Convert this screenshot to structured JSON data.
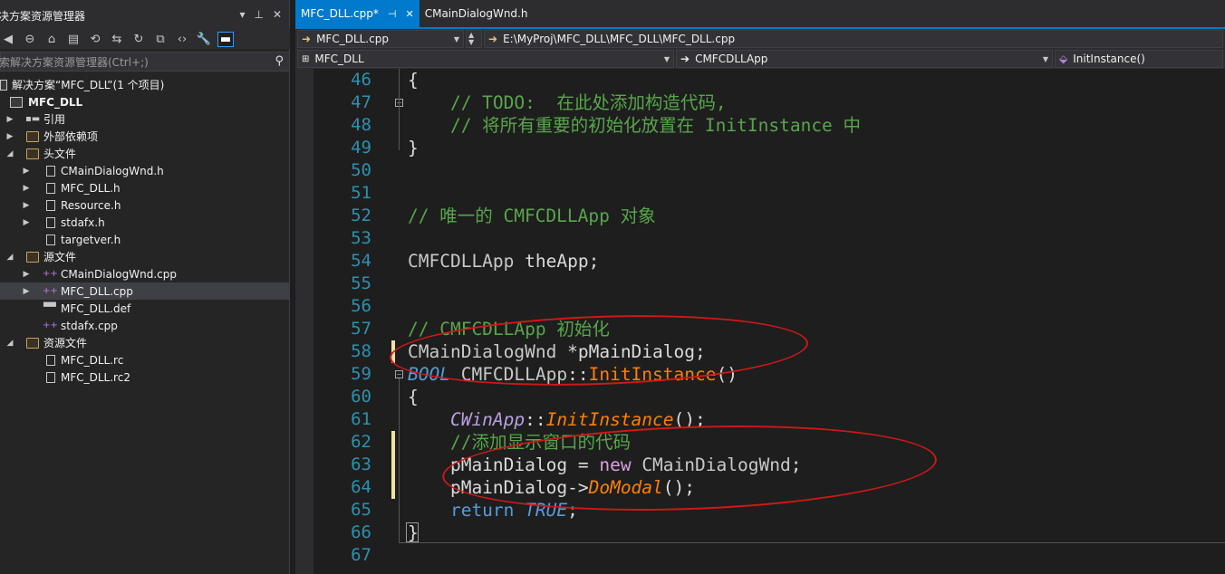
{
  "explorer": {
    "title": "决方案资源管理器",
    "search_placeholder": "索解决方案资源管理器(Ctrl+;)",
    "tree": [
      {
        "label": "解决方案“MFC_DLL”(1 个项目)",
        "icon": "solution-icon",
        "arrow": ""
      },
      {
        "label": "MFC_DLL",
        "icon": "project-icon",
        "arrow": ""
      },
      {
        "label": "引用",
        "icon": "references-icon",
        "arrow": "▶"
      },
      {
        "label": "外部依赖项",
        "icon": "folder-icon",
        "arrow": "▶"
      },
      {
        "label": "头文件",
        "icon": "folder-icon",
        "arrow": "◢"
      },
      {
        "label": "CMainDialogWnd.h",
        "icon": "header-file-icon",
        "arrow": "▶"
      },
      {
        "label": "MFC_DLL.h",
        "icon": "header-file-icon",
        "arrow": "▶"
      },
      {
        "label": "Resource.h",
        "icon": "header-file-icon",
        "arrow": "▶"
      },
      {
        "label": "stdafx.h",
        "icon": "header-file-icon",
        "arrow": "▶"
      },
      {
        "label": "targetver.h",
        "icon": "header-file-icon",
        "arrow": ""
      },
      {
        "label": "源文件",
        "icon": "folder-icon",
        "arrow": "◢"
      },
      {
        "label": "CMainDialogWnd.cpp",
        "icon": "cpp-file-icon",
        "arrow": "▶"
      },
      {
        "label": "MFC_DLL.cpp",
        "icon": "cpp-file-icon",
        "arrow": "▶"
      },
      {
        "label": "MFC_DLL.def",
        "icon": "def-file-icon",
        "arrow": ""
      },
      {
        "label": "stdafx.cpp",
        "icon": "cpp-file-icon",
        "arrow": ""
      },
      {
        "label": "资源文件",
        "icon": "folder-icon",
        "arrow": "◢"
      },
      {
        "label": "MFC_DLL.rc",
        "icon": "resource-file-icon",
        "arrow": ""
      },
      {
        "label": "MFC_DLL.rc2",
        "icon": "resource-file-icon",
        "arrow": ""
      }
    ]
  },
  "editor": {
    "tabs": [
      {
        "label": "MFC_DLL.cpp*"
      },
      {
        "label": "CMainDialogWnd.h"
      }
    ],
    "file_dropdown": "MFC_DLL.cpp",
    "file_path": "E:\\MyProj\\MFC_DLL\\MFC_DLL\\MFC_DLL.cpp",
    "project_dropdown": "MFC_DLL",
    "class_dropdown": "CMFCDLLApp",
    "member_dropdown": "InitInstance()"
  },
  "code": {
    "line_numbers": [
      "46",
      "47",
      "48",
      "49",
      "50",
      "51",
      "52",
      "53",
      "54",
      "55",
      "56",
      "57",
      "58",
      "59",
      "60",
      "61",
      "62",
      "63",
      "64",
      "65",
      "66",
      "67"
    ],
    "lines": {
      "l46": "{",
      "l47": "    // TODO:  在此处添加构造代码,",
      "l48": "    // 将所有重要的初始化放置在 InitInstance 中",
      "l49": "}",
      "l52": "// 唯一的 CMFCDLLApp 对象",
      "l54_type": "CMFCDLLApp",
      "l54_var": " theApp;",
      "l57": "// CMFCDLLApp 初始化",
      "l58_type": "CMainDialogWnd",
      "l58_rest": " *pMainDialog;",
      "l59_kw": "BOOL",
      "l59_cls": " CMFCDLLApp",
      "l59_sep": "::",
      "l59_fn": "InitInstance",
      "l59_paren": "()",
      "l60": "{",
      "l61_cls": "    CWinApp",
      "l61_sep": "::",
      "l61_fn": "InitInstance",
      "l61_end": "();",
      "l62": "    //添加显示窗口的代码",
      "l63_var": "    pMainDialog",
      "l63_eq": " = ",
      "l63_new": "new",
      "l63_type": " CMainDialogWnd",
      "l63_end": ";",
      "l64_var": "    pMainDialog",
      "l64_arrow": "->",
      "l64_fn": "DoModal",
      "l64_end": "();",
      "l65_kw": "    return",
      "l65_val": " TRUE",
      "l65_end": ";",
      "l66": "}"
    }
  },
  "colors": {
    "accent": "#007acc",
    "comment": "#57a64a",
    "keyword": "#569cd6",
    "function": "#ff8000",
    "line_number": "#2b91af",
    "annotation_red": "#d01818"
  }
}
